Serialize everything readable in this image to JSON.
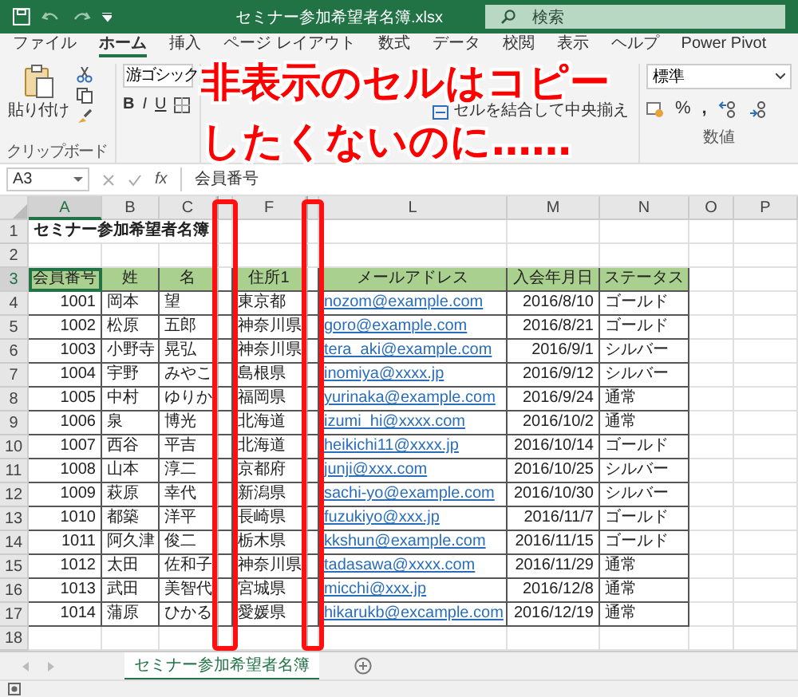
{
  "window": {
    "title": "セミナー参加希望者名簿.xlsx",
    "search_placeholder": "検索"
  },
  "menu_tabs": [
    {
      "label": "ファイル",
      "selected": false
    },
    {
      "label": "ホーム",
      "selected": true
    },
    {
      "label": "挿入",
      "selected": false
    },
    {
      "label": "ページ レイアウト",
      "selected": false
    },
    {
      "label": "数式",
      "selected": false
    },
    {
      "label": "データ",
      "selected": false
    },
    {
      "label": "校閲",
      "selected": false
    },
    {
      "label": "表示",
      "selected": false
    },
    {
      "label": "ヘルプ",
      "selected": false
    },
    {
      "label": "Power Pivot",
      "selected": false
    }
  ],
  "ribbon": {
    "paste_label": "貼り付け",
    "clipboard_group": "クリップボード",
    "font_name": "游ゴシック",
    "bold": "B",
    "italic": "I",
    "underline": "U",
    "merge_button": "セルを結合して中央揃え",
    "number_format": "標準",
    "percent": "%",
    "comma": ",",
    "number_group": "数値"
  },
  "formula_bar": {
    "name_box": "A3",
    "function_symbol": "fx",
    "value": "会員番号"
  },
  "annotation": {
    "lines": [
      "非表示のセルはコピー",
      "したくないのに……"
    ]
  },
  "sheet": {
    "columns": [
      {
        "kind": "col",
        "label": "A",
        "selected": true
      },
      {
        "kind": "col",
        "label": "B",
        "selected": false
      },
      {
        "kind": "col",
        "label": "C",
        "selected": false
      },
      {
        "kind": "hidden",
        "highlighted": true
      },
      {
        "kind": "col",
        "label": "F",
        "selected": false
      },
      {
        "kind": "hidden",
        "highlighted": true
      },
      {
        "kind": "col",
        "label": "L",
        "selected": false
      },
      {
        "kind": "col",
        "label": "M",
        "selected": false
      },
      {
        "kind": "col",
        "label": "N",
        "selected": false
      },
      {
        "kind": "col",
        "label": "O",
        "selected": false
      },
      {
        "kind": "col",
        "label": "P",
        "selected": false
      }
    ],
    "rows": [
      {
        "kind": "title",
        "number": "1",
        "selected": false,
        "cells": [
          "セミナー参加希望者名簿"
        ]
      },
      {
        "kind": "empty",
        "number": "2",
        "selected": false
      },
      {
        "kind": "header",
        "number": "3",
        "selected": true,
        "cells": [
          "会員番号",
          "姓",
          "名",
          "住所1",
          "メールアドレス",
          "入会年月日",
          "ステータス"
        ]
      },
      {
        "kind": "data",
        "number": "4",
        "selected": false,
        "cells": [
          "1001",
          "岡本",
          "望",
          "東京都",
          "nozom@example.com",
          "2016/8/10",
          "ゴールド"
        ]
      },
      {
        "kind": "data",
        "number": "5",
        "selected": false,
        "cells": [
          "1002",
          "松原",
          "五郎",
          "神奈川県",
          "goro@example.com",
          "2016/8/21",
          "ゴールド"
        ]
      },
      {
        "kind": "data",
        "number": "6",
        "selected": false,
        "cells": [
          "1003",
          "小野寺",
          "晃弘",
          "神奈川県",
          "tera_aki@example.com",
          "2016/9/1",
          "シルバー"
        ]
      },
      {
        "kind": "data",
        "number": "7",
        "selected": false,
        "cells": [
          "1004",
          "宇野",
          "みやこ",
          "島根県",
          "inomiya@xxxx.jp",
          "2016/9/12",
          "シルバー"
        ]
      },
      {
        "kind": "data",
        "number": "8",
        "selected": false,
        "cells": [
          "1005",
          "中村",
          "ゆりか",
          "福岡県",
          "yurinaka@example.com",
          "2016/9/24",
          "通常"
        ]
      },
      {
        "kind": "data",
        "number": "9",
        "selected": false,
        "cells": [
          "1006",
          "泉",
          "博光",
          "北海道",
          "izumi_hi@xxxx.com",
          "2016/10/2",
          "通常"
        ]
      },
      {
        "kind": "data",
        "number": "10",
        "selected": false,
        "cells": [
          "1007",
          "西谷",
          "平吉",
          "北海道",
          "heikichi11@xxxx.jp",
          "2016/10/14",
          "ゴールド"
        ]
      },
      {
        "kind": "data",
        "number": "11",
        "selected": false,
        "cells": [
          "1008",
          "山本",
          "淳二",
          "京都府",
          "junji@xxx.com",
          "2016/10/25",
          "シルバー"
        ]
      },
      {
        "kind": "data",
        "number": "12",
        "selected": false,
        "cells": [
          "1009",
          "萩原",
          "幸代",
          "新潟県",
          "sachi-yo@example.com",
          "2016/10/30",
          "シルバー"
        ]
      },
      {
        "kind": "data",
        "number": "13",
        "selected": false,
        "cells": [
          "1010",
          "都築",
          "洋平",
          "長崎県",
          "fuzukiyo@xxx.jp",
          "2016/11/7",
          "ゴールド"
        ]
      },
      {
        "kind": "data",
        "number": "14",
        "selected": false,
        "cells": [
          "1011",
          "阿久津",
          "俊二",
          "栃木県",
          "kkshun@example.com",
          "2016/11/15",
          "ゴールド"
        ]
      },
      {
        "kind": "data",
        "number": "15",
        "selected": false,
        "cells": [
          "1012",
          "太田",
          "佐和子",
          "神奈川県",
          "tadasawa@xxxx.com",
          "2016/11/29",
          "通常"
        ]
      },
      {
        "kind": "data",
        "number": "16",
        "selected": false,
        "cells": [
          "1013",
          "武田",
          "美智代",
          "宮城県",
          "micchi@xxx.jp",
          "2016/12/8",
          "通常"
        ]
      },
      {
        "kind": "data",
        "number": "17",
        "selected": false,
        "cells": [
          "1014",
          "蒲原",
          "ひかる",
          "愛媛県",
          "hikarukb@excample.com",
          "2016/12/19",
          "通常"
        ]
      },
      {
        "kind": "empty",
        "number": "18",
        "selected": false
      }
    ]
  },
  "sheet_tabs": [
    {
      "label": "セミナー参加希望者名簿",
      "selected": true
    }
  ]
}
